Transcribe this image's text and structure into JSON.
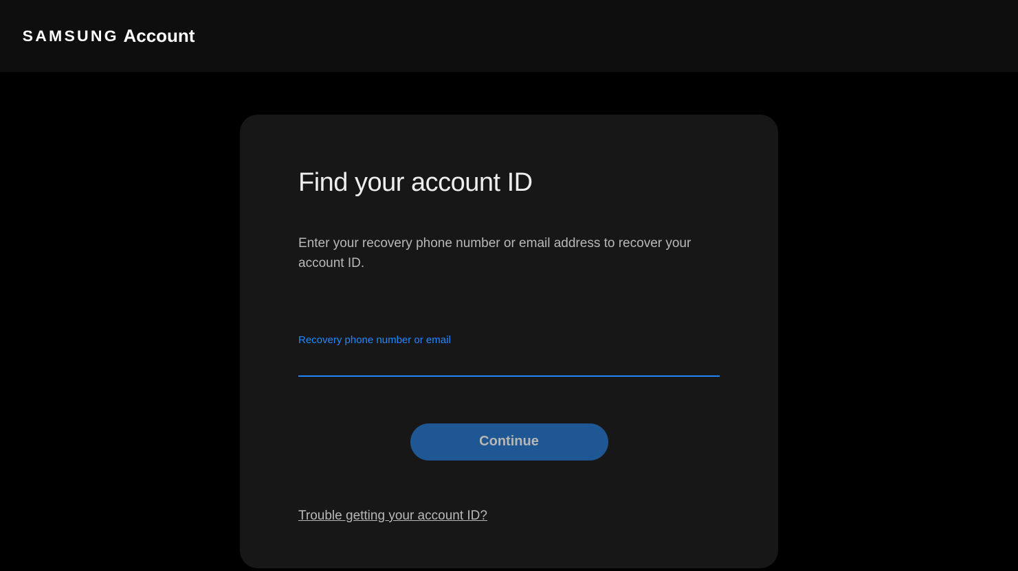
{
  "header": {
    "brand": "SAMSUNG",
    "product": "Account"
  },
  "main": {
    "title": "Find your account ID",
    "description": "Enter your recovery phone number or email address to recover your account ID.",
    "input": {
      "label": "Recovery phone number or email",
      "value": ""
    },
    "continue_label": "Continue",
    "trouble_link": "Trouble getting your account ID?"
  }
}
